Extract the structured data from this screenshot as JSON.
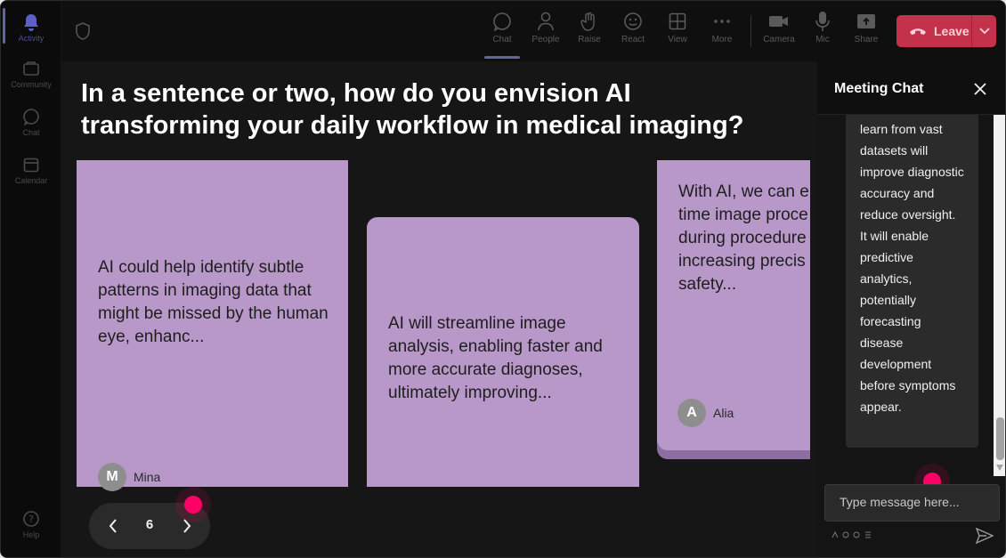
{
  "rail": {
    "items": [
      {
        "label": "Activity",
        "icon": "bell-icon"
      },
      {
        "label": "Community",
        "icon": "community-icon"
      },
      {
        "label": "Chat",
        "icon": "chat-icon"
      },
      {
        "label": "Calendar",
        "icon": "calendar-icon"
      },
      {
        "label": "Help",
        "icon": "help-icon"
      }
    ]
  },
  "toolbar": {
    "chat": "Chat",
    "people": "People",
    "raise": "Raise",
    "react": "React",
    "view": "View",
    "more": "More",
    "camera": "Camera",
    "mic": "Mic",
    "share": "Share",
    "leave": "Leave"
  },
  "question": "In a sentence or two, how do you envision AI transforming your daily workflow in medical imaging?",
  "cards": [
    {
      "text": "AI could help identify subtle patterns in imaging data that might be missed by the human eye, enhanc...",
      "author": "Mina",
      "initial": "M"
    },
    {
      "text": "AI will streamline image analysis, enabling faster and more accurate diagnoses, ultimately improving...",
      "author": "",
      "initial": ""
    },
    {
      "text": "With AI, we can e time image proce during procedure increasing precis safety...",
      "author": "Alia",
      "initial": "A"
    }
  ],
  "pager": {
    "page": "6"
  },
  "chat": {
    "title": "Meeting Chat",
    "message": "learn from vast datasets will improve diagnostic accuracy and reduce oversight. It will enable predictive analytics, potentially forecasting disease development before symptoms appear.",
    "input_placeholder": "Type message here..."
  },
  "colors": {
    "card": "#b897c9",
    "leave": "#c4314b",
    "accent": "#6264a7",
    "pointer": "#ff0066"
  }
}
